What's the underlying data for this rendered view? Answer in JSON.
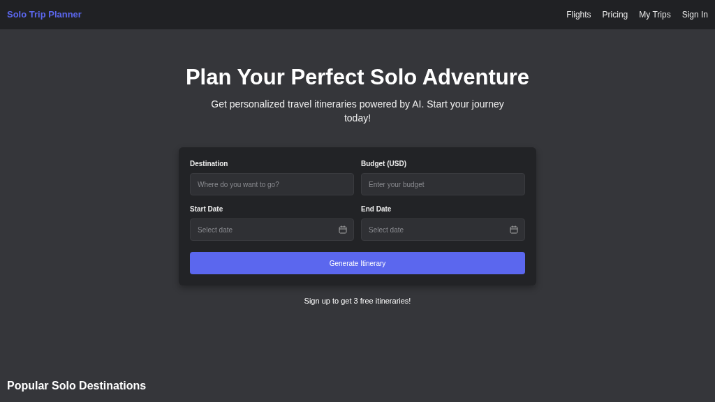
{
  "navbar": {
    "brand": "Solo Trip Planner",
    "links": [
      "Flights",
      "Pricing",
      "My Trips",
      "Sign In"
    ]
  },
  "hero": {
    "title": "Plan Your Perfect Solo Adventure",
    "subtitle": "Get personalized travel itineraries powered by AI. Start your journey today!"
  },
  "form": {
    "fields": [
      {
        "label": "Destination",
        "placeholder": "Where do you want to go?",
        "kind": "text"
      },
      {
        "label": "Budget (USD)",
        "placeholder": "Enter your budget",
        "kind": "text"
      },
      {
        "label": "Start Date",
        "placeholder": "Select date",
        "kind": "date"
      },
      {
        "label": "End Date",
        "placeholder": "Select date",
        "kind": "date"
      }
    ],
    "button": "Generate Itinerary"
  },
  "signup_note": "Sign up to get 3 free itineraries!",
  "section_title": "Popular Solo Destinations"
}
